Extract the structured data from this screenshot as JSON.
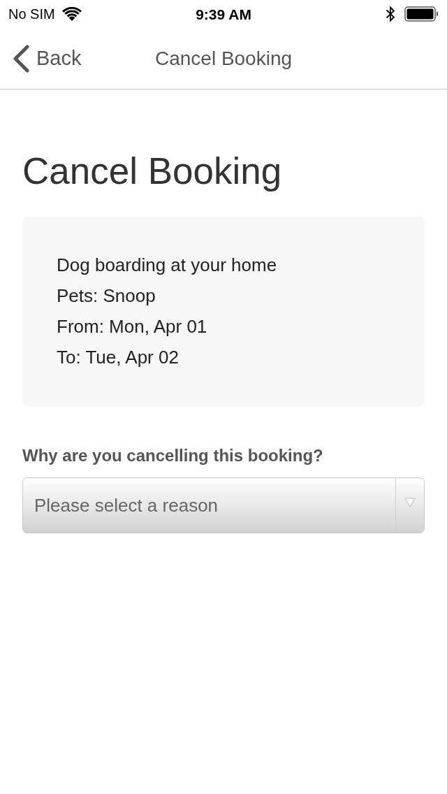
{
  "status_bar": {
    "carrier": "No SIM",
    "time": "9:39 AM"
  },
  "nav_bar": {
    "back": "Back",
    "title": "Cancel Booking"
  },
  "heading": "Cancel Booking",
  "booking_card": {
    "lines": [
      "Dog boarding at your home",
      "Pets: Snoop",
      "From: Mon, Apr 01",
      "To: Tue, Apr 02"
    ]
  },
  "reason": {
    "label": "Why are you cancelling this booking?",
    "select": {
      "placeholder": "Please select a reason"
    }
  }
}
